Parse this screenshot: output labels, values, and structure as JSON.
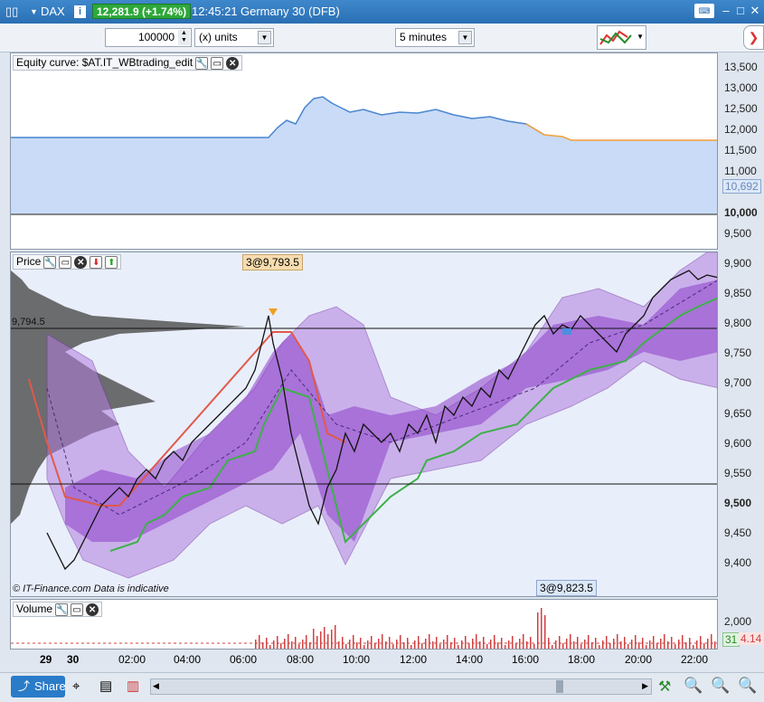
{
  "titlebar": {
    "instrument": "DAX",
    "last_price": "12,281.9 (+1.74%)",
    "time": "12:45:21",
    "market": "Germany 30 (DFB)"
  },
  "toolbar": {
    "quantity": "100000",
    "units": "(x) units",
    "timeframe": "5 minutes"
  },
  "equity_panel": {
    "label": "Equity curve: $AT.IT_WBtrading_edit",
    "axis_ticks": [
      "13,500",
      "13,000",
      "12,500",
      "12,000",
      "11,500",
      "11,000",
      "10,692",
      "10,000",
      "9,500"
    ]
  },
  "price_panel": {
    "label": "Price",
    "order_tag_top": "3@9,793.5",
    "order_tag_bottom": "3@9,823.5",
    "line_label": "9,794.5",
    "copyright": "© IT-Finance.com Data is indicative",
    "axis_ticks": [
      "9,900",
      "9,850",
      "9,800",
      "9,750",
      "9,700",
      "9,650",
      "9,600",
      "9,550",
      "9,500",
      "9,450",
      "9,400"
    ]
  },
  "volume_panel": {
    "label": "Volume",
    "axis_ticks": [
      "2,000",
      "31",
      "4.14"
    ]
  },
  "time_axis": [
    "29",
    "30",
    "02:00",
    "04:00",
    "06:00",
    "08:00",
    "10:00",
    "12:00",
    "14:00",
    "16:00",
    "18:00",
    "20:00",
    "22:00"
  ],
  "bottom": {
    "share": "Share"
  },
  "colors": {
    "equity_fill": "#c9dbf7",
    "equity_line": "#4a86d0",
    "equity_line_alt": "#f4a03a",
    "band": "#9c4fc9",
    "trail": "#3fb04a",
    "stop": "#e05a4a",
    "price_bg": "#e9eefb"
  }
}
